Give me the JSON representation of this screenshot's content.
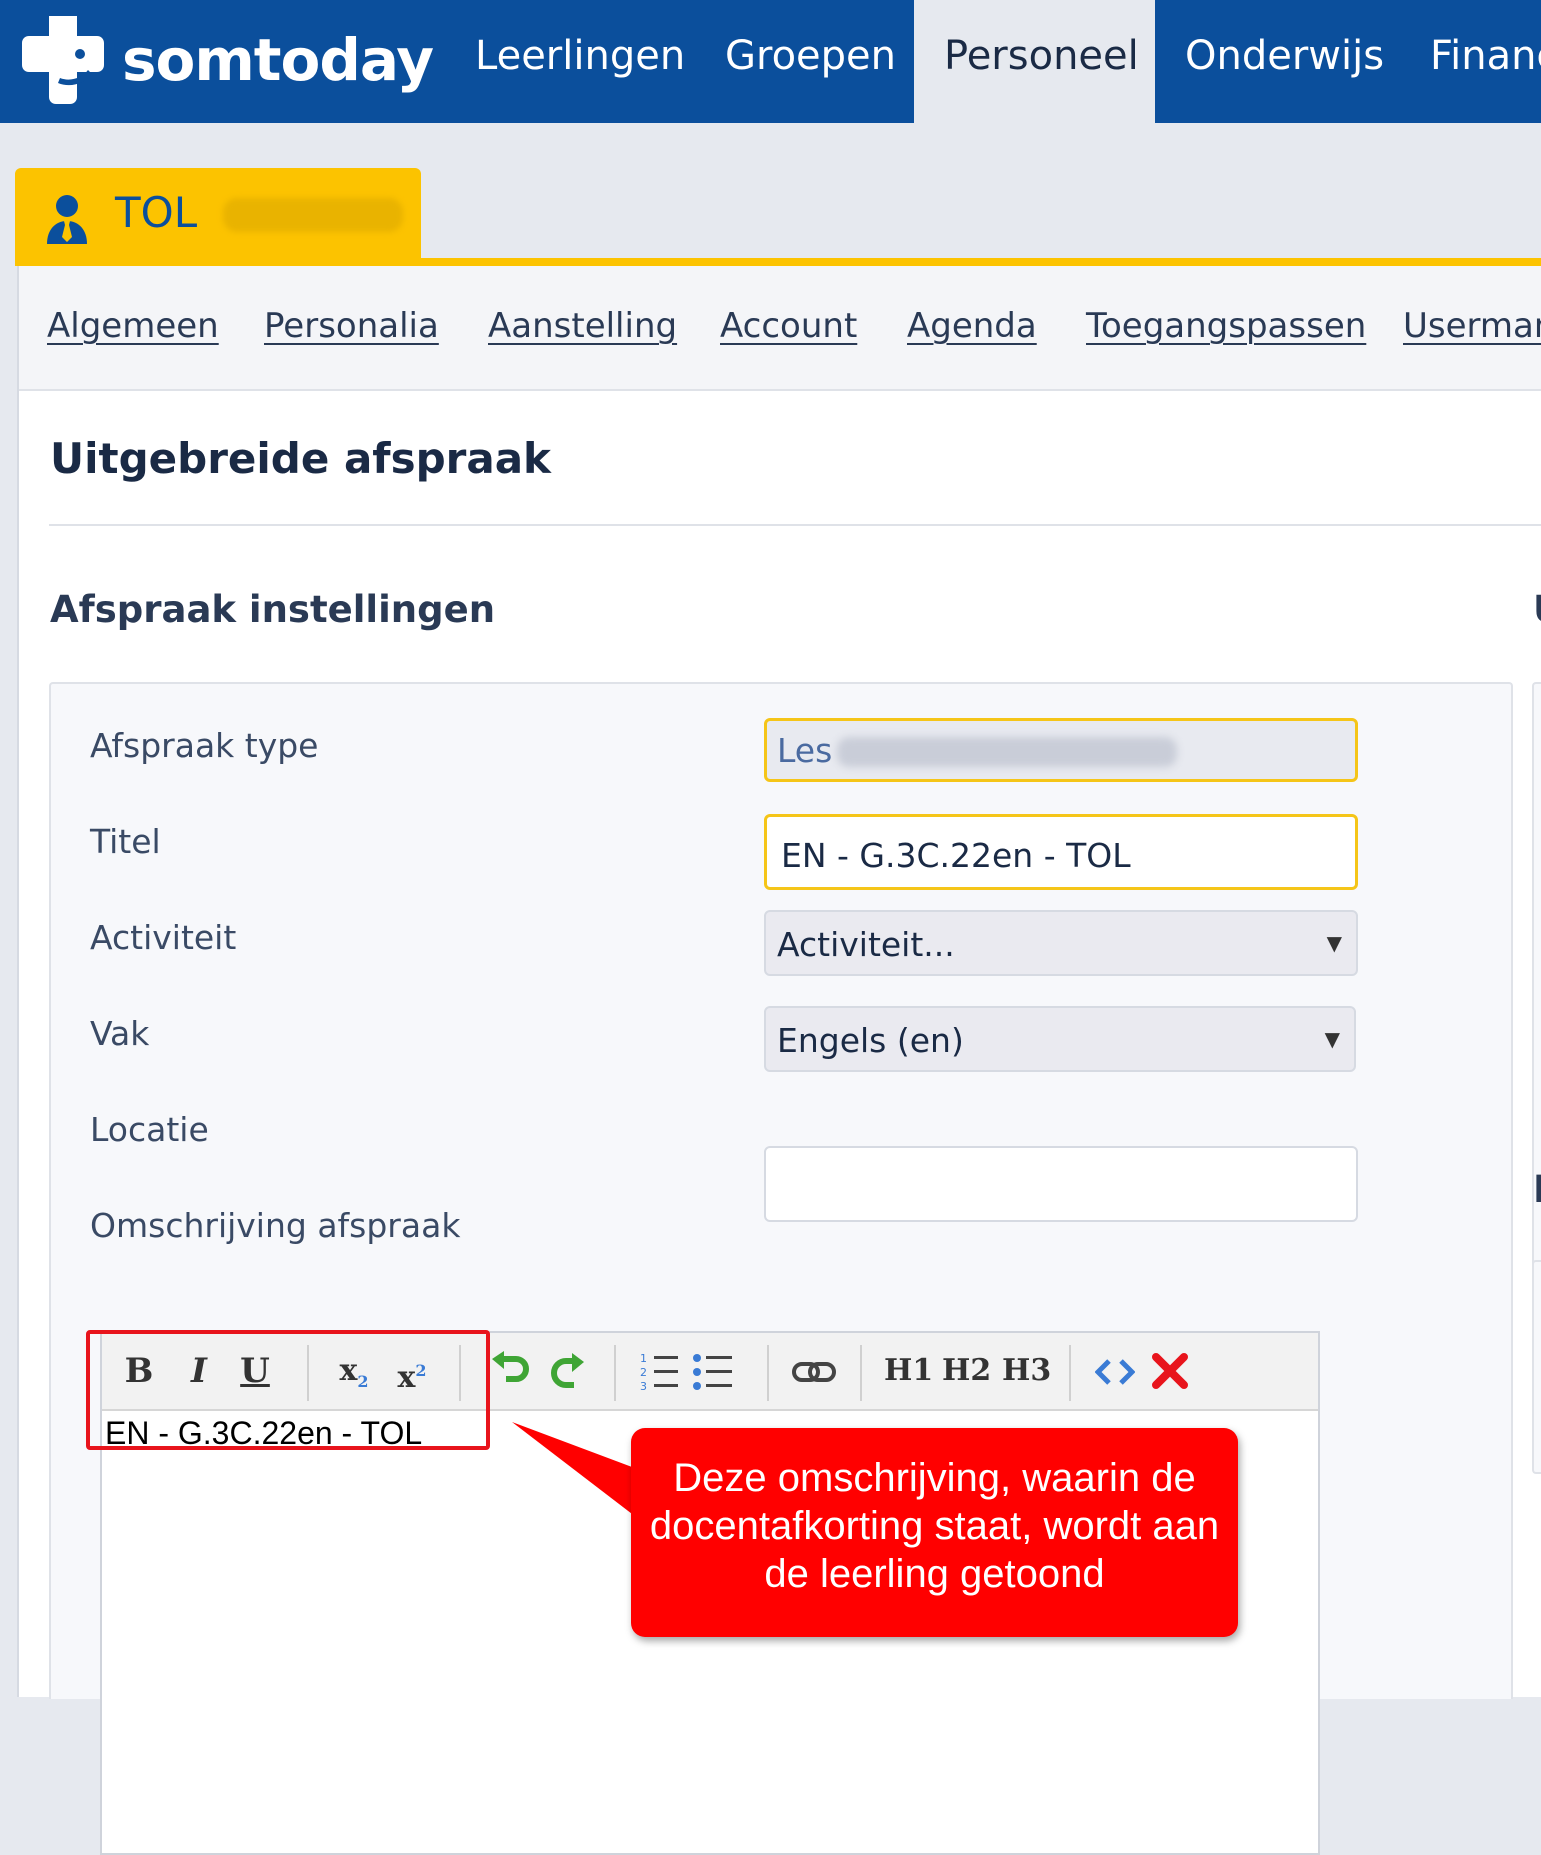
{
  "app": {
    "name": "somtoday"
  },
  "topnav": {
    "items": [
      {
        "label": "Leerlingen"
      },
      {
        "label": "Groepen"
      },
      {
        "label": "Personeel",
        "active": true
      },
      {
        "label": "Onderwijs"
      },
      {
        "label": "Financ"
      }
    ]
  },
  "person": {
    "code": "TOL",
    "icon": "user-icon"
  },
  "subtabs": [
    {
      "label": "Algemeen"
    },
    {
      "label": "Personalia"
    },
    {
      "label": "Aanstelling"
    },
    {
      "label": "Account"
    },
    {
      "label": "Agenda"
    },
    {
      "label": "Toegangspassen"
    },
    {
      "label": "Userman"
    }
  ],
  "page": {
    "title": "Uitgebreide afspraak",
    "section_title": "Afspraak instellingen",
    "side_section_u": "U",
    "side_section_e": "E"
  },
  "form": {
    "type": {
      "label": "Afspraak type",
      "value": "Les"
    },
    "titel": {
      "label": "Titel",
      "value": "EN - G.3C.22en - TOL"
    },
    "activiteit": {
      "label": "Activiteit",
      "value": "Activiteit..."
    },
    "vak": {
      "label": "Vak",
      "value": "Engels (en)"
    },
    "locatie": {
      "label": "Locatie",
      "value": ""
    },
    "omschrijving": {
      "label": "Omschrijving afspraak",
      "value": "EN - G.3C.22en - TOL"
    }
  },
  "editor_toolbar": {
    "buttons": [
      "bold-icon",
      "italic-icon",
      "underline-icon",
      "subscript-icon",
      "superscript-icon",
      "undo-icon",
      "redo-icon",
      "ordered-list-icon",
      "unordered-list-icon",
      "link-icon",
      "h1",
      "h2",
      "h3",
      "source-code-icon",
      "clear-format-icon"
    ],
    "h1": "H1",
    "h2": "H2",
    "h3": "H3"
  },
  "annotation": {
    "text": "Deze omschrijving, waarin de docentafkorting staat, wordt aan de leerling getoond",
    "color": "#ff0000"
  },
  "colors": {
    "brand_blue": "#0b4f9c",
    "accent_yellow": "#fcc300"
  }
}
